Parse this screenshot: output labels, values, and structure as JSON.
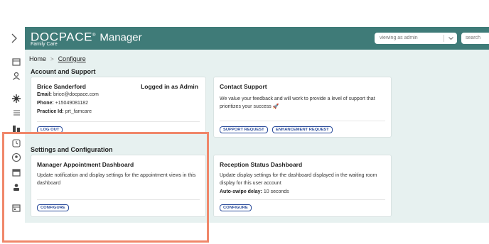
{
  "header": {
    "brand_name": "DOCPACE",
    "brand_suffix": "Manager",
    "practice_name": "Family Care",
    "viewing_as": "viewing as admin",
    "search_placeholder": "search"
  },
  "breadcrumb": {
    "home": "Home",
    "current": "Configure"
  },
  "sections": {
    "account": "Account and Support",
    "settings": "Settings and Configuration"
  },
  "account_card": {
    "name": "Brice Sanderford",
    "status": "Logged in as Admin",
    "email_label": "Email:",
    "email": "brice@docpace.com",
    "phone_label": "Phone:",
    "phone": "+15049081182",
    "practice_label": "Practice Id:",
    "practice": "prt_famcare",
    "logout": "LOG OUT"
  },
  "support_card": {
    "title": "Contact Support",
    "description": "We value your feedback and will work to provide a level of support that prioritizes your success 🚀",
    "support_button": "SUPPORT REQUEST",
    "enhancement_button": "ENHANCEMENT REQUEST"
  },
  "appointment_card": {
    "title": "Manager Appointment Dashboard",
    "description": "Update notification and display settings for the appointment views in this dashboard",
    "configure": "CONFIGURE"
  },
  "reception_card": {
    "title": "Reception Status Dashboard",
    "description": "Update display settings for the dashboard displayed in the waiting room display for this user account",
    "delay_label": "Auto-swipe delay:",
    "delay_value": "10 seconds",
    "configure": "CONFIGURE"
  },
  "colors": {
    "header": "#3f7b78",
    "content_bg": "#e7f1f0",
    "button": "#2b4c9b",
    "highlight": "#f0876a"
  }
}
